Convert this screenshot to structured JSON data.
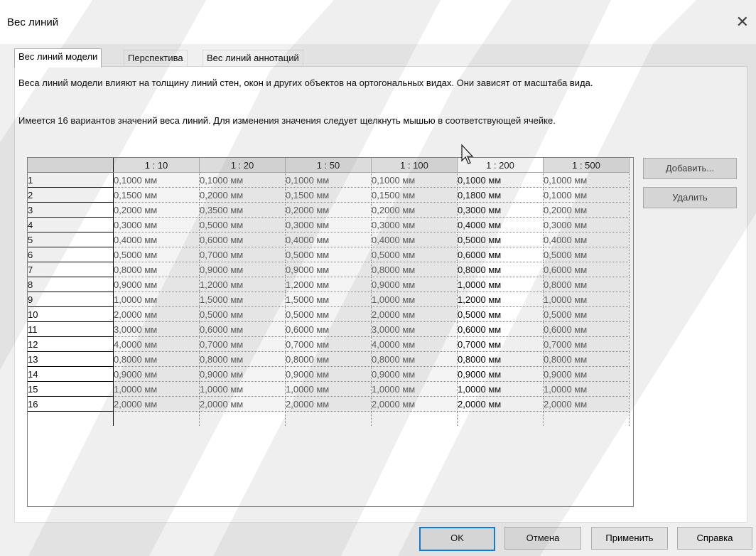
{
  "window": {
    "title": "Вес линий"
  },
  "tabs": [
    {
      "label": "Вес линий модели"
    },
    {
      "label": "Перспектива"
    },
    {
      "label": "Вес линий аннотаций"
    }
  ],
  "description": {
    "line1": "Веса линий модели влияют на толщину линий стен, окон и других объектов на ортогональных видах. Они зависят от масштаба вида.",
    "line2": "Имеется 16 вариантов значений веса линий. Для изменения значения следует щелкнуть мышью в соответствующей ячейке."
  },
  "grid": {
    "columns": [
      "1 : 10",
      "1 : 20",
      "1 : 50",
      "1 : 100",
      "1 : 200",
      "1 : 500"
    ],
    "selected_column": "1 : 200",
    "rows": [
      {
        "n": "1",
        "values": [
          "0,1000 мм",
          "0,1000 мм",
          "0,1000 мм",
          "0,1000 мм",
          "0,1000 мм",
          "0,1000 мм"
        ]
      },
      {
        "n": "2",
        "values": [
          "0,1500 мм",
          "0,2000 мм",
          "0,1500 мм",
          "0,1500 мм",
          "0,1800 мм",
          "0,1000 мм"
        ]
      },
      {
        "n": "3",
        "values": [
          "0,2000 мм",
          "0,3500 мм",
          "0,2000 мм",
          "0,2000 мм",
          "0,3000 мм",
          "0,2000 мм"
        ]
      },
      {
        "n": "4",
        "values": [
          "0,3000 мм",
          "0,5000 мм",
          "0,3000 мм",
          "0,3000 мм",
          "0,4000 мм",
          "0,3000 мм"
        ]
      },
      {
        "n": "5",
        "values": [
          "0,4000 мм",
          "0,6000 мм",
          "0,4000 мм",
          "0,4000 мм",
          "0,5000 мм",
          "0,4000 мм"
        ]
      },
      {
        "n": "6",
        "values": [
          "0,5000 мм",
          "0,7000 мм",
          "0,5000 мм",
          "0,5000 мм",
          "0,6000 мм",
          "0,5000 мм"
        ]
      },
      {
        "n": "7",
        "values": [
          "0,8000 мм",
          "0,9000 мм",
          "0,9000 мм",
          "0,8000 мм",
          "0,8000 мм",
          "0,6000 мм"
        ]
      },
      {
        "n": "8",
        "values": [
          "0,9000 мм",
          "1,2000 мм",
          "1,2000 мм",
          "0,9000 мм",
          "1,0000 мм",
          "0,8000 мм"
        ]
      },
      {
        "n": "9",
        "values": [
          "1,0000 мм",
          "1,5000 мм",
          "1,5000 мм",
          "1,0000 мм",
          "1,2000 мм",
          "1,0000 мм"
        ]
      },
      {
        "n": "10",
        "values": [
          "2,0000 мм",
          "0,5000 мм",
          "0,5000 мм",
          "2,0000 мм",
          "0,5000 мм",
          "0,5000 мм"
        ]
      },
      {
        "n": "11",
        "values": [
          "3,0000 мм",
          "0,6000 мм",
          "0,6000 мм",
          "3,0000 мм",
          "0,6000 мм",
          "0,6000 мм"
        ]
      },
      {
        "n": "12",
        "values": [
          "4,0000 мм",
          "0,7000 мм",
          "0,7000 мм",
          "4,0000 мм",
          "0,7000 мм",
          "0,7000 мм"
        ]
      },
      {
        "n": "13",
        "values": [
          "0,8000 мм",
          "0,8000 мм",
          "0,8000 мм",
          "0,8000 мм",
          "0,8000 мм",
          "0,8000 мм"
        ]
      },
      {
        "n": "14",
        "values": [
          "0,9000 мм",
          "0,9000 мм",
          "0,9000 мм",
          "0,9000 мм",
          "0,9000 мм",
          "0,9000 мм"
        ]
      },
      {
        "n": "15",
        "values": [
          "1,0000 мм",
          "1,0000 мм",
          "1,0000 мм",
          "1,0000 мм",
          "1,0000 мм",
          "1,0000 мм"
        ]
      },
      {
        "n": "16",
        "values": [
          "2,0000 мм",
          "2,0000 мм",
          "2,0000 мм",
          "2,0000 мм",
          "2,0000 мм",
          "2,0000 мм"
        ]
      }
    ]
  },
  "side_buttons": {
    "add": "Добавить...",
    "delete": "Удалить"
  },
  "footer_buttons": {
    "ok": "OK",
    "cancel": "Отмена",
    "apply": "Применить",
    "help": "Справка"
  },
  "icons": {
    "close": "close-icon",
    "cursor": "mouse-pointer-icon"
  },
  "colors": {
    "accent": "#0078d7",
    "watermark": "#8c8c8c"
  }
}
